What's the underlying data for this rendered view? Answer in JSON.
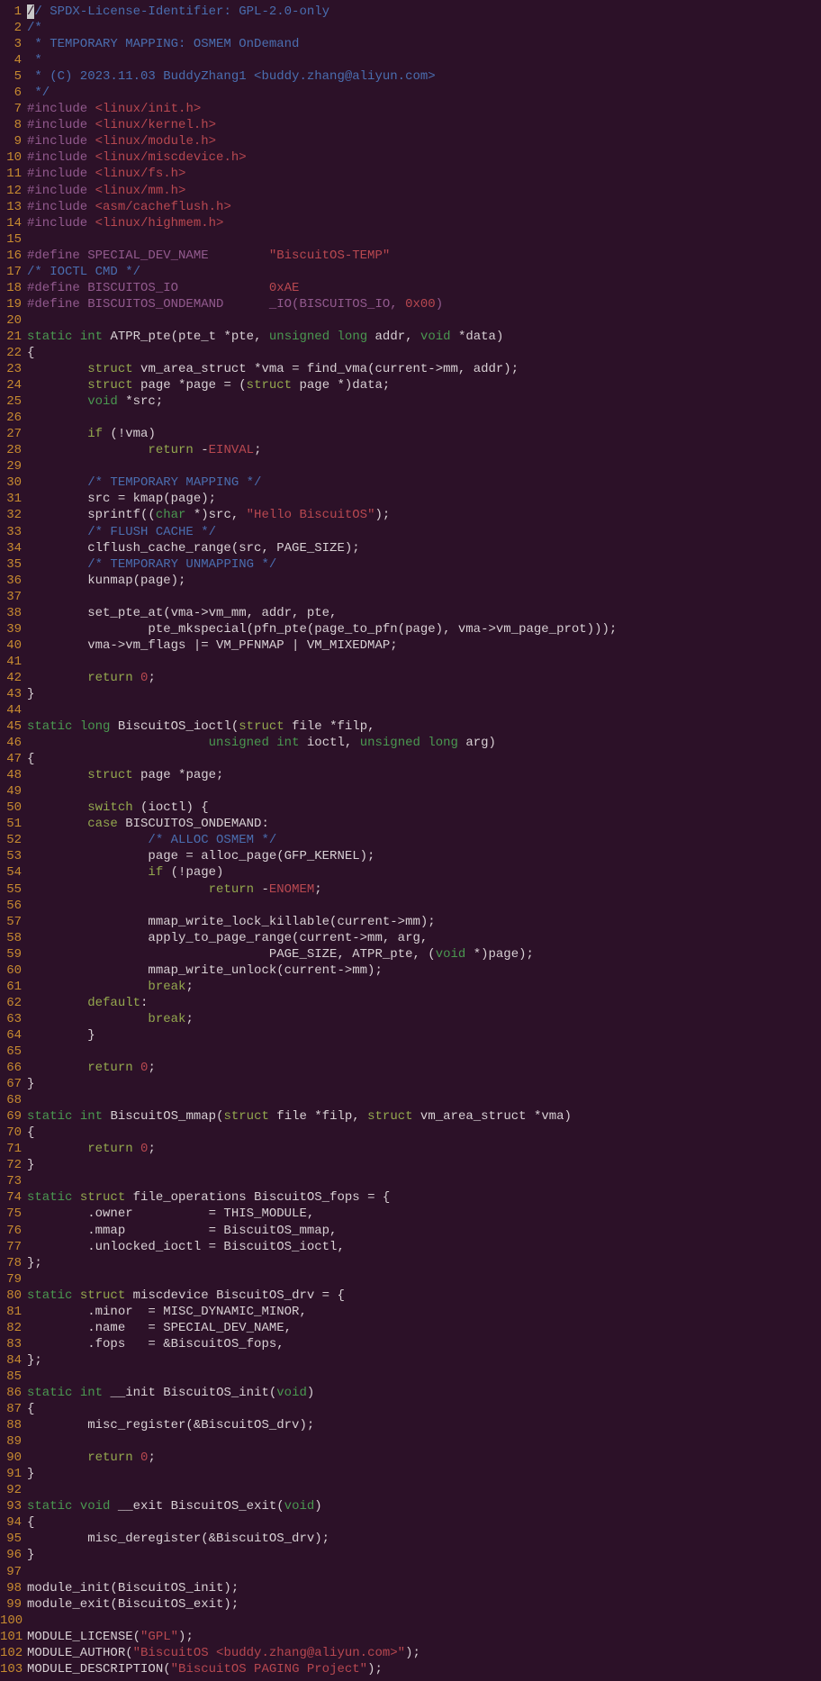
{
  "lines": [
    [
      [
        "cursor",
        "/"
      ],
      [
        "c-comment",
        "/ SPDX-License-Identifier: GPL-2.0-only"
      ]
    ],
    [
      [
        "c-comment",
        "/*"
      ]
    ],
    [
      [
        "c-comment",
        " * TEMPORARY MAPPING: OSMEM OnDemand"
      ]
    ],
    [
      [
        "c-comment",
        " *"
      ]
    ],
    [
      [
        "c-comment",
        " * (C) 2023.11.03 BuddyZhang1 <buddy.zhang@aliyun.com>"
      ]
    ],
    [
      [
        "c-comment",
        " */"
      ]
    ],
    [
      [
        "c-preproc",
        "#include "
      ],
      [
        "c-incpath",
        "<linux/init.h>"
      ]
    ],
    [
      [
        "c-preproc",
        "#include "
      ],
      [
        "c-incpath",
        "<linux/kernel.h>"
      ]
    ],
    [
      [
        "c-preproc",
        "#include "
      ],
      [
        "c-incpath",
        "<linux/module.h>"
      ]
    ],
    [
      [
        "c-preproc",
        "#include "
      ],
      [
        "c-incpath",
        "<linux/miscdevice.h>"
      ]
    ],
    [
      [
        "c-preproc",
        "#include "
      ],
      [
        "c-incpath",
        "<linux/fs.h>"
      ]
    ],
    [
      [
        "c-preproc",
        "#include "
      ],
      [
        "c-incpath",
        "<linux/mm.h>"
      ]
    ],
    [
      [
        "c-preproc",
        "#include "
      ],
      [
        "c-incpath",
        "<asm/cacheflush.h>"
      ]
    ],
    [
      [
        "c-preproc",
        "#include "
      ],
      [
        "c-incpath",
        "<linux/highmem.h>"
      ]
    ],
    [
      [
        "c-text",
        ""
      ]
    ],
    [
      [
        "c-preproc",
        "#define SPECIAL_DEV_NAME        "
      ],
      [
        "c-string",
        "\"BiscuitOS-TEMP\""
      ]
    ],
    [
      [
        "c-comment",
        "/* IOCTL CMD */"
      ]
    ],
    [
      [
        "c-preproc",
        "#define BISCUITOS_IO            "
      ],
      [
        "c-number",
        "0xAE"
      ]
    ],
    [
      [
        "c-preproc",
        "#define BISCUITOS_ONDEMAND      _IO(BISCUITOS_IO, "
      ],
      [
        "c-number",
        "0x00"
      ],
      [
        "c-preproc",
        ")"
      ]
    ],
    [
      [
        "c-text",
        ""
      ]
    ],
    [
      [
        "c-type",
        "static"
      ],
      [
        "c-text",
        " "
      ],
      [
        "c-type",
        "int"
      ],
      [
        "c-text",
        " ATPR_pte(pte_t *pte, "
      ],
      [
        "c-type",
        "unsigned"
      ],
      [
        "c-text",
        " "
      ],
      [
        "c-type",
        "long"
      ],
      [
        "c-text",
        " addr, "
      ],
      [
        "c-type",
        "void"
      ],
      [
        "c-text",
        " *data)"
      ]
    ],
    [
      [
        "c-text",
        "{"
      ]
    ],
    [
      [
        "c-text",
        "        "
      ],
      [
        "c-keyword",
        "struct"
      ],
      [
        "c-text",
        " vm_area_struct *vma = find_vma(current->mm, addr);"
      ]
    ],
    [
      [
        "c-text",
        "        "
      ],
      [
        "c-keyword",
        "struct"
      ],
      [
        "c-text",
        " page *page = ("
      ],
      [
        "c-keyword",
        "struct"
      ],
      [
        "c-text",
        " page *)data;"
      ]
    ],
    [
      [
        "c-text",
        "        "
      ],
      [
        "c-type",
        "void"
      ],
      [
        "c-text",
        " *src;"
      ]
    ],
    [
      [
        "c-text",
        ""
      ]
    ],
    [
      [
        "c-text",
        "        "
      ],
      [
        "c-keyword",
        "if"
      ],
      [
        "c-text",
        " (!vma)"
      ]
    ],
    [
      [
        "c-text",
        "                "
      ],
      [
        "c-keyword",
        "return"
      ],
      [
        "c-text",
        " -"
      ],
      [
        "c-const",
        "EINVAL"
      ],
      [
        "c-text",
        ";"
      ]
    ],
    [
      [
        "c-text",
        ""
      ]
    ],
    [
      [
        "c-text",
        "        "
      ],
      [
        "c-comment",
        "/* TEMPORARY MAPPING */"
      ]
    ],
    [
      [
        "c-text",
        "        src = kmap(page);"
      ]
    ],
    [
      [
        "c-text",
        "        sprintf(("
      ],
      [
        "c-type",
        "char"
      ],
      [
        "c-text",
        " *)src, "
      ],
      [
        "c-string",
        "\"Hello BiscuitOS\""
      ],
      [
        "c-text",
        ");"
      ]
    ],
    [
      [
        "c-text",
        "        "
      ],
      [
        "c-comment",
        "/* FLUSH CACHE */"
      ]
    ],
    [
      [
        "c-text",
        "        clflush_cache_range(src, PAGE_SIZE);"
      ]
    ],
    [
      [
        "c-text",
        "        "
      ],
      [
        "c-comment",
        "/* TEMPORARY UNMAPPING */"
      ]
    ],
    [
      [
        "c-text",
        "        kunmap(page);"
      ]
    ],
    [
      [
        "c-text",
        ""
      ]
    ],
    [
      [
        "c-text",
        "        set_pte_at(vma->vm_mm, addr, pte,"
      ]
    ],
    [
      [
        "c-text",
        "                pte_mkspecial(pfn_pte(page_to_pfn(page), vma->vm_page_prot)));"
      ]
    ],
    [
      [
        "c-text",
        "        vma->vm_flags |= VM_PFNMAP | VM_MIXEDMAP;"
      ]
    ],
    [
      [
        "c-text",
        ""
      ]
    ],
    [
      [
        "c-text",
        "        "
      ],
      [
        "c-keyword",
        "return"
      ],
      [
        "c-text",
        " "
      ],
      [
        "c-number",
        "0"
      ],
      [
        "c-text",
        ";"
      ]
    ],
    [
      [
        "c-text",
        "}"
      ]
    ],
    [
      [
        "c-text",
        ""
      ]
    ],
    [
      [
        "c-type",
        "static"
      ],
      [
        "c-text",
        " "
      ],
      [
        "c-type",
        "long"
      ],
      [
        "c-text",
        " BiscuitOS_ioctl("
      ],
      [
        "c-keyword",
        "struct"
      ],
      [
        "c-text",
        " file *filp,"
      ]
    ],
    [
      [
        "c-text",
        "                        "
      ],
      [
        "c-type",
        "unsigned"
      ],
      [
        "c-text",
        " "
      ],
      [
        "c-type",
        "int"
      ],
      [
        "c-text",
        " ioctl, "
      ],
      [
        "c-type",
        "unsigned"
      ],
      [
        "c-text",
        " "
      ],
      [
        "c-type",
        "long"
      ],
      [
        "c-text",
        " arg)"
      ]
    ],
    [
      [
        "c-text",
        "{"
      ]
    ],
    [
      [
        "c-text",
        "        "
      ],
      [
        "c-keyword",
        "struct"
      ],
      [
        "c-text",
        " page *page;"
      ]
    ],
    [
      [
        "c-text",
        ""
      ]
    ],
    [
      [
        "c-text",
        "        "
      ],
      [
        "c-keyword",
        "switch"
      ],
      [
        "c-text",
        " (ioctl) {"
      ]
    ],
    [
      [
        "c-text",
        "        "
      ],
      [
        "c-keyword",
        "case"
      ],
      [
        "c-text",
        " BISCUITOS_ONDEMAND:"
      ]
    ],
    [
      [
        "c-text",
        "                "
      ],
      [
        "c-comment",
        "/* ALLOC OSMEM */"
      ]
    ],
    [
      [
        "c-text",
        "                page = alloc_page(GFP_KERNEL);"
      ]
    ],
    [
      [
        "c-text",
        "                "
      ],
      [
        "c-keyword",
        "if"
      ],
      [
        "c-text",
        " (!page)"
      ]
    ],
    [
      [
        "c-text",
        "                        "
      ],
      [
        "c-keyword",
        "return"
      ],
      [
        "c-text",
        " -"
      ],
      [
        "c-const",
        "ENOMEM"
      ],
      [
        "c-text",
        ";"
      ]
    ],
    [
      [
        "c-text",
        ""
      ]
    ],
    [
      [
        "c-text",
        "                mmap_write_lock_killable(current->mm);"
      ]
    ],
    [
      [
        "c-text",
        "                apply_to_page_range(current->mm, arg,"
      ]
    ],
    [
      [
        "c-text",
        "                                PAGE_SIZE, ATPR_pte, ("
      ],
      [
        "c-type",
        "void"
      ],
      [
        "c-text",
        " *)page);"
      ]
    ],
    [
      [
        "c-text",
        "                mmap_write_unlock(current->mm);"
      ]
    ],
    [
      [
        "c-text",
        "                "
      ],
      [
        "c-keyword",
        "break"
      ],
      [
        "c-text",
        ";"
      ]
    ],
    [
      [
        "c-text",
        "        "
      ],
      [
        "c-keyword",
        "default"
      ],
      [
        "c-text",
        ":"
      ]
    ],
    [
      [
        "c-text",
        "                "
      ],
      [
        "c-keyword",
        "break"
      ],
      [
        "c-text",
        ";"
      ]
    ],
    [
      [
        "c-text",
        "        }"
      ]
    ],
    [
      [
        "c-text",
        ""
      ]
    ],
    [
      [
        "c-text",
        "        "
      ],
      [
        "c-keyword",
        "return"
      ],
      [
        "c-text",
        " "
      ],
      [
        "c-number",
        "0"
      ],
      [
        "c-text",
        ";"
      ]
    ],
    [
      [
        "c-text",
        "}"
      ]
    ],
    [
      [
        "c-text",
        ""
      ]
    ],
    [
      [
        "c-type",
        "static"
      ],
      [
        "c-text",
        " "
      ],
      [
        "c-type",
        "int"
      ],
      [
        "c-text",
        " BiscuitOS_mmap("
      ],
      [
        "c-keyword",
        "struct"
      ],
      [
        "c-text",
        " file *filp, "
      ],
      [
        "c-keyword",
        "struct"
      ],
      [
        "c-text",
        " vm_area_struct *vma)"
      ]
    ],
    [
      [
        "c-text",
        "{"
      ]
    ],
    [
      [
        "c-text",
        "        "
      ],
      [
        "c-keyword",
        "return"
      ],
      [
        "c-text",
        " "
      ],
      [
        "c-number",
        "0"
      ],
      [
        "c-text",
        ";"
      ]
    ],
    [
      [
        "c-text",
        "}"
      ]
    ],
    [
      [
        "c-text",
        ""
      ]
    ],
    [
      [
        "c-type",
        "static"
      ],
      [
        "c-text",
        " "
      ],
      [
        "c-keyword",
        "struct"
      ],
      [
        "c-text",
        " file_operations BiscuitOS_fops = {"
      ]
    ],
    [
      [
        "c-text",
        "        .owner          = THIS_MODULE,"
      ]
    ],
    [
      [
        "c-text",
        "        .mmap           = BiscuitOS_mmap,"
      ]
    ],
    [
      [
        "c-text",
        "        .unlocked_ioctl = BiscuitOS_ioctl,"
      ]
    ],
    [
      [
        "c-text",
        "};"
      ]
    ],
    [
      [
        "c-text",
        ""
      ]
    ],
    [
      [
        "c-type",
        "static"
      ],
      [
        "c-text",
        " "
      ],
      [
        "c-keyword",
        "struct"
      ],
      [
        "c-text",
        " miscdevice BiscuitOS_drv = {"
      ]
    ],
    [
      [
        "c-text",
        "        .minor  = MISC_DYNAMIC_MINOR,"
      ]
    ],
    [
      [
        "c-text",
        "        .name   = SPECIAL_DEV_NAME,"
      ]
    ],
    [
      [
        "c-text",
        "        .fops   = &BiscuitOS_fops,"
      ]
    ],
    [
      [
        "c-text",
        "};"
      ]
    ],
    [
      [
        "c-text",
        ""
      ]
    ],
    [
      [
        "c-type",
        "static"
      ],
      [
        "c-text",
        " "
      ],
      [
        "c-type",
        "int"
      ],
      [
        "c-text",
        " __init BiscuitOS_init("
      ],
      [
        "c-type",
        "void"
      ],
      [
        "c-text",
        ")"
      ]
    ],
    [
      [
        "c-text",
        "{"
      ]
    ],
    [
      [
        "c-text",
        "        misc_register(&BiscuitOS_drv);"
      ]
    ],
    [
      [
        "c-text",
        ""
      ]
    ],
    [
      [
        "c-text",
        "        "
      ],
      [
        "c-keyword",
        "return"
      ],
      [
        "c-text",
        " "
      ],
      [
        "c-number",
        "0"
      ],
      [
        "c-text",
        ";"
      ]
    ],
    [
      [
        "c-text",
        "}"
      ]
    ],
    [
      [
        "c-text",
        ""
      ]
    ],
    [
      [
        "c-type",
        "static"
      ],
      [
        "c-text",
        " "
      ],
      [
        "c-type",
        "void"
      ],
      [
        "c-text",
        " __exit BiscuitOS_exit("
      ],
      [
        "c-type",
        "void"
      ],
      [
        "c-text",
        ")"
      ]
    ],
    [
      [
        "c-text",
        "{"
      ]
    ],
    [
      [
        "c-text",
        "        misc_deregister(&BiscuitOS_drv);"
      ]
    ],
    [
      [
        "c-text",
        "}"
      ]
    ],
    [
      [
        "c-text",
        ""
      ]
    ],
    [
      [
        "c-text",
        "module_init(BiscuitOS_init);"
      ]
    ],
    [
      [
        "c-text",
        "module_exit(BiscuitOS_exit);"
      ]
    ],
    [
      [
        "c-text",
        ""
      ]
    ],
    [
      [
        "c-text",
        "MODULE_LICENSE("
      ],
      [
        "c-string",
        "\"GPL\""
      ],
      [
        "c-text",
        ");"
      ]
    ],
    [
      [
        "c-text",
        "MODULE_AUTHOR("
      ],
      [
        "c-string",
        "\"BiscuitOS <buddy.zhang@aliyun.com>\""
      ],
      [
        "c-text",
        ");"
      ]
    ],
    [
      [
        "c-text",
        "MODULE_DESCRIPTION("
      ],
      [
        "c-string",
        "\"BiscuitOS PAGING Project\""
      ],
      [
        "c-text",
        ");"
      ]
    ]
  ]
}
